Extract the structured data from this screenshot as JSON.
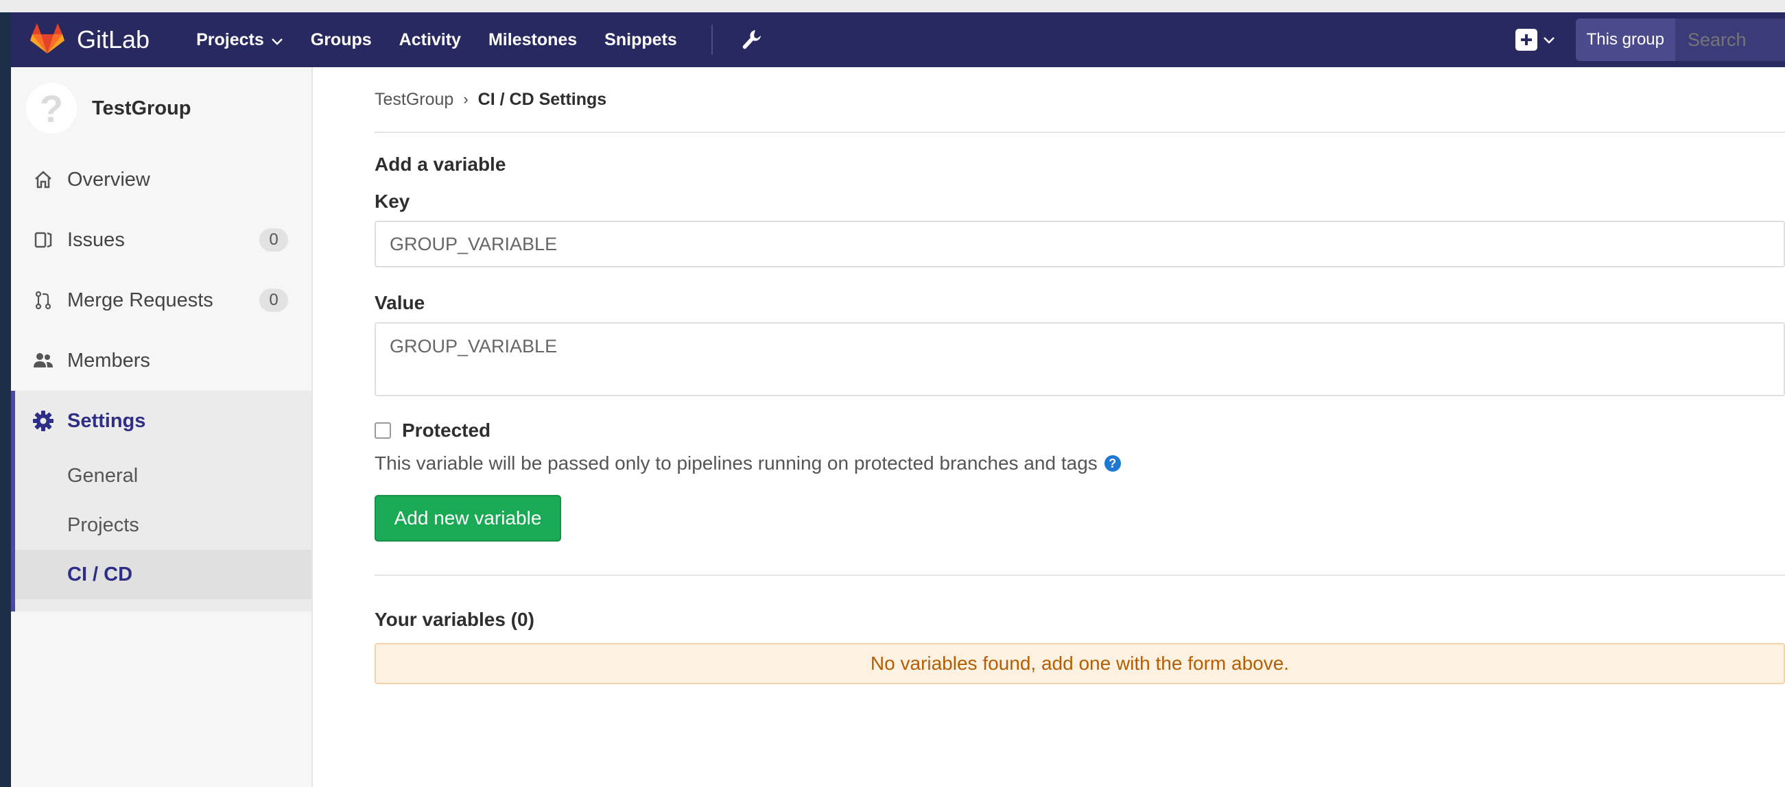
{
  "navbar": {
    "brand": "GitLab",
    "links": [
      "Projects",
      "Groups",
      "Activity",
      "Milestones",
      "Snippets"
    ],
    "search_scope": "This group",
    "search_placeholder": "Search",
    "colors": {
      "navbar_bg": "#292961",
      "accent": "#4b4ba3"
    }
  },
  "sidebar": {
    "group_name": "TestGroup",
    "avatar_glyph": "?",
    "items": [
      {
        "label": "Overview",
        "icon": "home-icon"
      },
      {
        "label": "Issues",
        "icon": "issues-icon",
        "count": "0"
      },
      {
        "label": "Merge Requests",
        "icon": "merge-request-icon",
        "count": "0"
      },
      {
        "label": "Members",
        "icon": "users-icon"
      }
    ],
    "settings": {
      "label": "Settings",
      "icon": "gear-icon",
      "sub_items": [
        "General",
        "Projects",
        "CI / CD"
      ],
      "active_sub": "CI / CD"
    }
  },
  "breadcrumb": {
    "parent": "TestGroup",
    "separator": "›",
    "current": "CI / CD Settings"
  },
  "form": {
    "section_title": "Add a variable",
    "key_label": "Key",
    "key_value": "GROUP_VARIABLE",
    "value_label": "Value",
    "value_value": "GROUP_VARIABLE",
    "protected_label": "Protected",
    "protected_checked": false,
    "help_text": "This variable will be passed only to pipelines running on protected branches and tags",
    "help_icon": "?",
    "submit_label": "Add new variable"
  },
  "variables": {
    "title": "Your variables (0)",
    "empty_message": "No variables found, add one with the form above."
  }
}
